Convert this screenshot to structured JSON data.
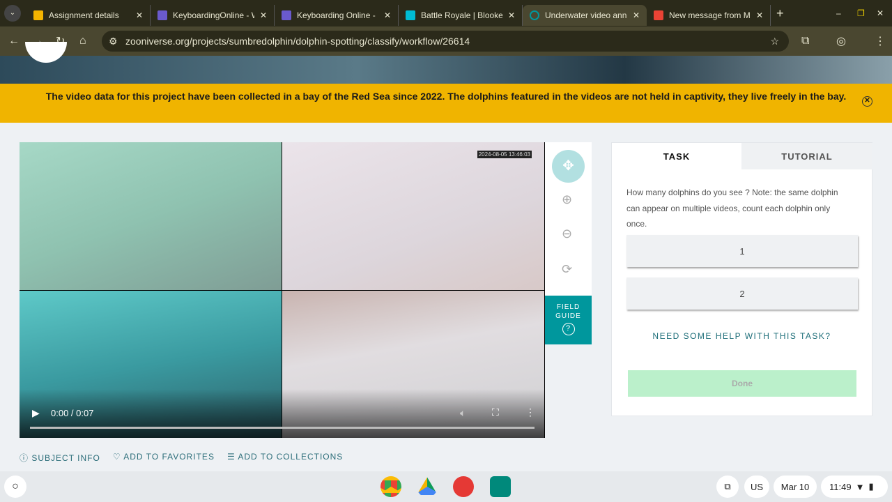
{
  "browser": {
    "tabs": [
      {
        "label": "Assignment details",
        "color": "#f4b400"
      },
      {
        "label": "KeyboardingOnline - W",
        "color": "#6a5acd"
      },
      {
        "label": "Keyboarding Online - L",
        "color": "#6a5acd"
      },
      {
        "label": "Battle Royale | Blooket",
        "color": "#00bcd4"
      },
      {
        "label": "Underwater video ann",
        "color": "#00979d"
      },
      {
        "label": "New message from M",
        "color": "#ea4335"
      }
    ],
    "url": "zooniverse.org/projects/sumbredolphin/dolphin-spotting/classify/workflow/26614"
  },
  "banner": {
    "text": "The video data for this project have been collected in a bay of the Red Sea since 2022. The dolphins featured in the videos are not held in captivity, they live freely in the bay."
  },
  "video": {
    "timestamp": "2024-08-05 13:46:03",
    "time": "0:00 / 0:07",
    "progress": 0
  },
  "tools": {
    "field_guide": "FIELD GUIDE"
  },
  "panel": {
    "tabs": [
      "TASK",
      "TUTORIAL"
    ],
    "question": "How many dolphins do you see ? Note: the same dolphin can appear on multiple videos, count each dolphin only once.",
    "answers": [
      "1",
      "2"
    ],
    "help": "NEED SOME HELP WITH THIS TASK?",
    "done": "Done"
  },
  "actions": [
    "SUBJECT INFO",
    "ADD TO FAVORITES",
    "ADD TO COLLECTIONS"
  ],
  "shelf": {
    "ime": "US",
    "date": "Mar 10",
    "time": "11:49"
  }
}
